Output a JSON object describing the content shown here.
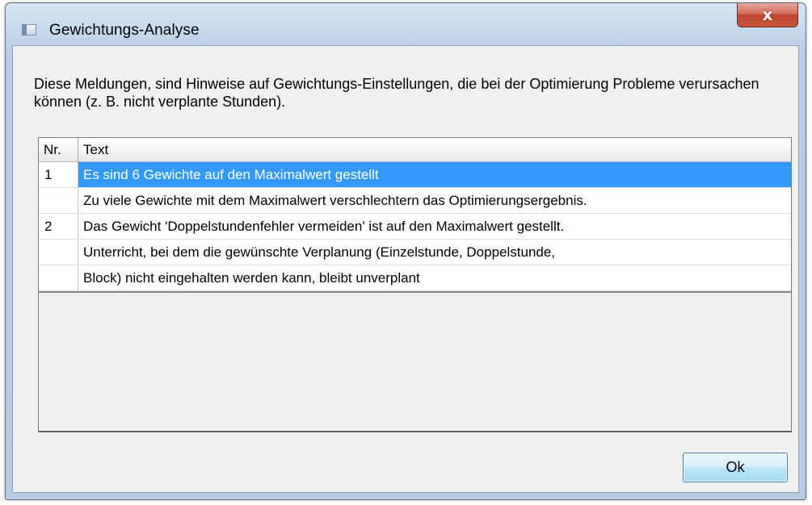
{
  "window": {
    "title": "Gewichtungs-Analyse",
    "close_label": "x"
  },
  "description": "Diese Meldungen, sind Hinweise auf Gewichtungs-Einstellungen, die bei der Optimierung Probleme verursachen können (z. B. nicht verplante Stunden).",
  "table": {
    "headers": {
      "nr": "Nr.",
      "text": "Text"
    },
    "rows": [
      {
        "nr": "1",
        "text": "Es sind 6 Gewichte auf den Maximalwert gestellt",
        "selected": true
      },
      {
        "nr": "",
        "text": "Zu viele Gewichte mit dem Maximalwert verschlechtern das Optimierungsergebnis.",
        "selected": false
      },
      {
        "nr": "2",
        "text": "Das Gewicht 'Doppelstundenfehler vermeiden' ist auf den Maximalwert gestellt.",
        "selected": false
      },
      {
        "nr": "",
        "text": "Unterricht, bei dem die gewünschte Verplanung (Einzelstunde, Doppelstunde,",
        "selected": false
      },
      {
        "nr": "",
        "text": "Block) nicht eingehalten werden kann, bleibt unverplant",
        "selected": false
      }
    ]
  },
  "buttons": {
    "ok_label": "Ok"
  },
  "colors": {
    "selection": "#3399ff",
    "close_button": "#c7563d",
    "dialog_background": "#f0f0f0"
  },
  "icons": {
    "title": "window-app-icon",
    "close": "close-icon"
  }
}
